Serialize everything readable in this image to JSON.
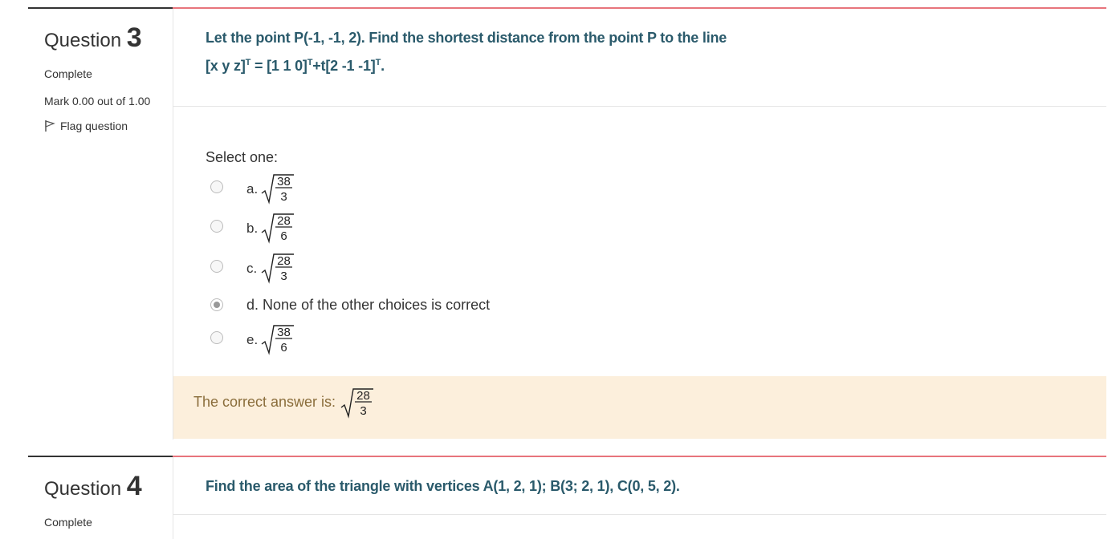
{
  "q3": {
    "label": "Question",
    "number": "3",
    "state": "Complete",
    "mark": "Mark 0.00 out of 1.00",
    "flag": "Flag question",
    "text_line1": "Let the point P(-1, -1, 2). Find the shortest distance from the point P to the line",
    "text_line2_a": "[x  y  z]",
    "text_line2_b": " = [1  1  0]",
    "text_line2_c": "+t[2  -1  -1]",
    "text_line2_d": ".",
    "sup_t": "T",
    "select_one": "Select one:",
    "options": [
      {
        "letter": "a.",
        "numerator": "38",
        "denominator": "3",
        "checked": false
      },
      {
        "letter": "b.",
        "numerator": "28",
        "denominator": "6",
        "checked": false
      },
      {
        "letter": "c.",
        "numerator": "28",
        "denominator": "3",
        "checked": false
      },
      {
        "letter": "d.",
        "text": "None of the other choices is correct",
        "checked": true
      },
      {
        "letter": "e.",
        "numerator": "38",
        "denominator": "6",
        "checked": false
      }
    ],
    "correct_label": "The correct answer is:",
    "correct_numerator": "28",
    "correct_denominator": "3"
  },
  "q4": {
    "label": "Question",
    "number": "4",
    "state": "Complete",
    "text": "Find the area of the triangle with vertices A(1, 2, 1); B(3; 2, 1), C(0, 5, 2)."
  },
  "colors": {
    "accent_rule": "#e8747c",
    "question_text": "#2a5a6b",
    "feedback_bg": "#fcefdc",
    "feedback_text": "#8a6d3b"
  }
}
